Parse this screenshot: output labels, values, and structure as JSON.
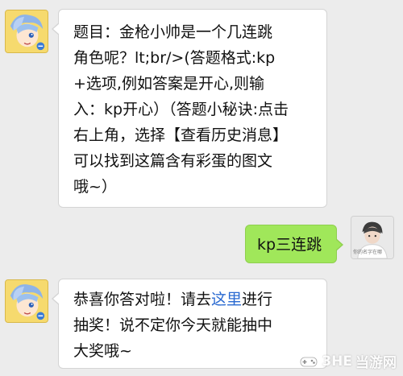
{
  "messages": [
    {
      "sender": "bot",
      "lines": [
        "题目：金枪小帅是一个几连跳",
        "角色呢？lt;br/>(答题格式:kp",
        "+选项,例如答案是开心,则输",
        "入：kp开心）（答题小秘诀:点击",
        "右上角，选择【查看历史消息】",
        "可以找到这篇含有彩蛋的图文",
        "哦~）"
      ]
    },
    {
      "sender": "user",
      "lines": [
        "kp三连跳"
      ],
      "avatar_caption": "你的名字在哪"
    },
    {
      "sender": "bot",
      "line1_prefix": "恭喜你答对啦！请去",
      "line1_link": "这里",
      "line1_suffix": "进行",
      "lines_rest": [
        "抽奖！说不定你今天就能抽中",
        "大奖哦~"
      ],
      "link_color": "#2a6ad1"
    }
  ],
  "watermark": {
    "brand": "3HE",
    "site": "当游网"
  },
  "colors": {
    "background": "#ececec",
    "bot_bubble": "#ffffff",
    "user_bubble": "#a0e75a"
  }
}
